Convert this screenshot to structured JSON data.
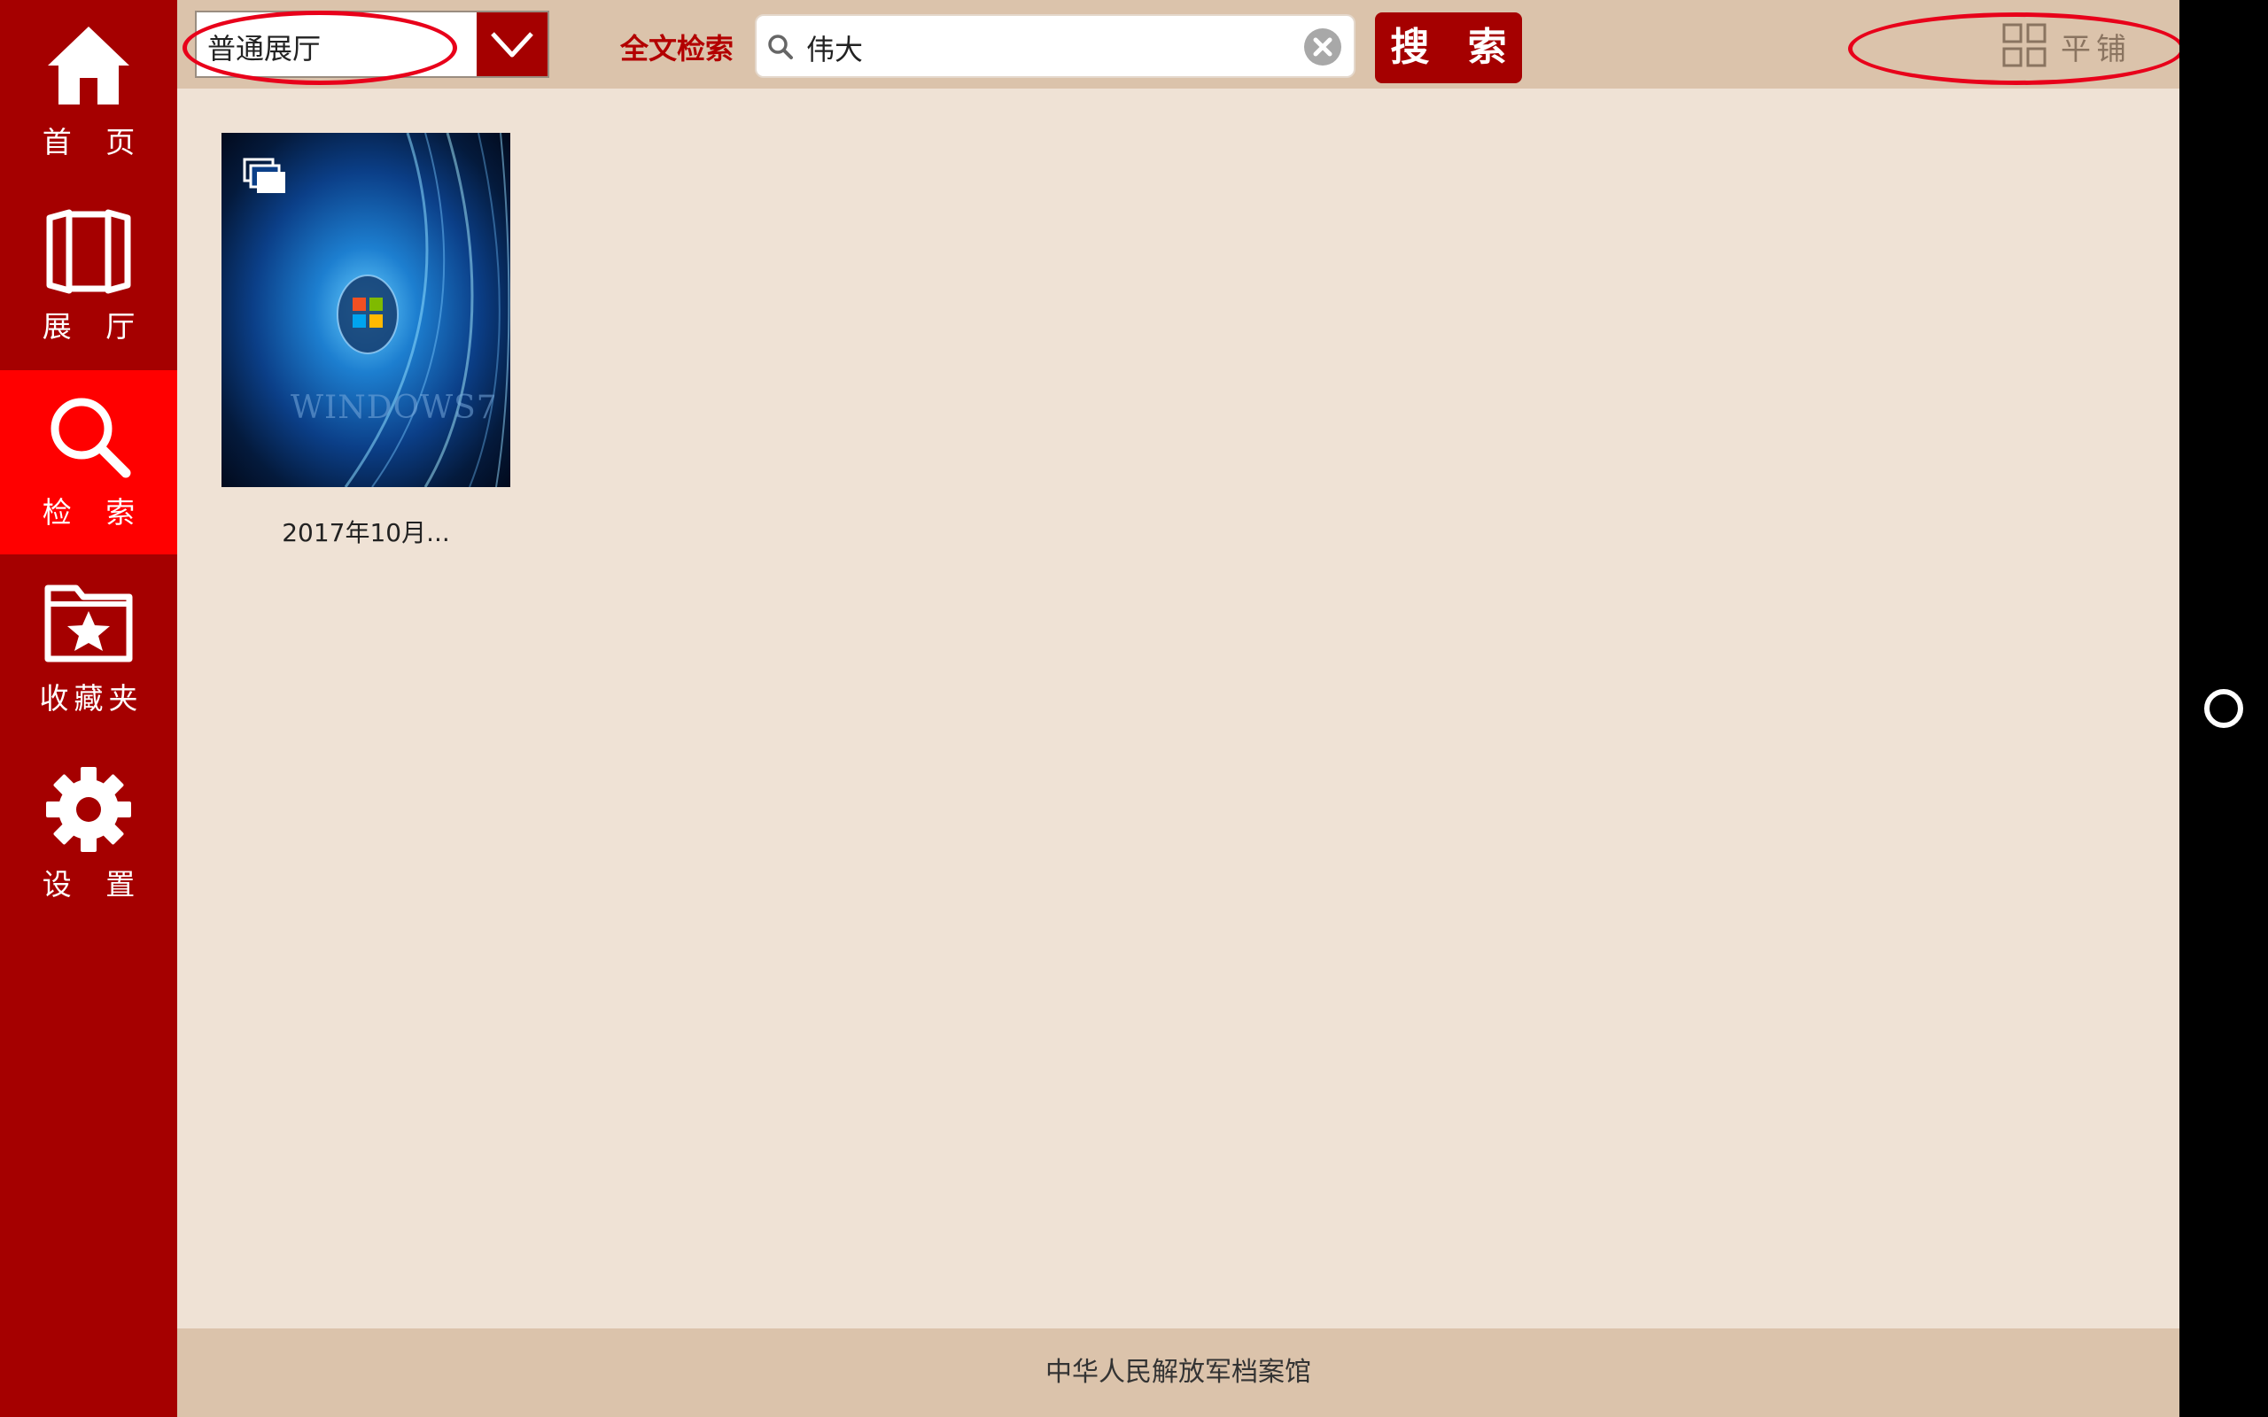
{
  "sidebar": {
    "items": [
      {
        "label": "首 页",
        "icon": "home-icon",
        "active": false
      },
      {
        "label": "展 厅",
        "icon": "hall-icon",
        "active": false
      },
      {
        "label": "检 索",
        "icon": "search-icon",
        "active": true
      },
      {
        "label": "收藏夹",
        "icon": "folder-star-icon",
        "active": false
      },
      {
        "label": "设 置",
        "icon": "gear-icon",
        "active": false
      }
    ]
  },
  "toolbar": {
    "hall_select_value": "普通展厅",
    "fulltext_label": "全文检索",
    "search_value": "伟大",
    "search_button_label": "搜 索",
    "view_toggle_label": "平铺",
    "view_toggle_icon": "grid-icon"
  },
  "results": [
    {
      "caption": "2017年10月...",
      "thumbnail_text": "WINDOWS7",
      "badge_icon": "gallery-icon"
    }
  ],
  "footer": {
    "text": "中华人民解放军档案馆"
  },
  "colors": {
    "sidebar": "#a50000",
    "sidebar_active": "#ff0000",
    "topbar": "#dbc3ab",
    "content": "#efe2d5",
    "annotation": "#e8001a"
  }
}
